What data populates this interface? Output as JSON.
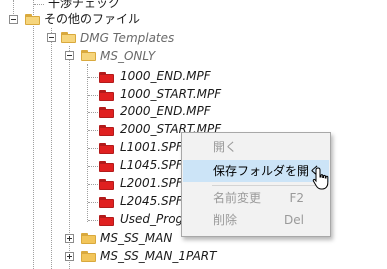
{
  "tree": {
    "items": [
      {
        "label": "干渉チェック"
      },
      {
        "label": "その他のファイル"
      },
      {
        "label": "DMG Templates"
      },
      {
        "label": "MS_ONLY"
      },
      {
        "label": "1000_END.MPF"
      },
      {
        "label": "1000_START.MPF"
      },
      {
        "label": "2000_END.MPF"
      },
      {
        "label": "2000_START.MPF"
      },
      {
        "label": "L1001.SPF"
      },
      {
        "label": "L1045.SPF"
      },
      {
        "label": "L2001.SPF"
      },
      {
        "label": "L2045.SPF"
      },
      {
        "label": "Used_Progr"
      },
      {
        "label": "MS_SS_MAN"
      },
      {
        "label": "MS_SS_MAN_1PART"
      }
    ]
  },
  "context_menu": {
    "open": {
      "label": "開く",
      "enabled": false
    },
    "open_folder": {
      "label": "保存フォルダを開く",
      "enabled": true,
      "hover": true
    },
    "rename": {
      "label": "名前変更",
      "shortcut": "F2",
      "enabled": false
    },
    "delete": {
      "label": "削除",
      "shortcut": "Del",
      "enabled": false
    }
  },
  "colors": {
    "folder_yellow": "#f2c55a",
    "folder_red": "#e02020",
    "menu_hover": "#cce4f7"
  }
}
